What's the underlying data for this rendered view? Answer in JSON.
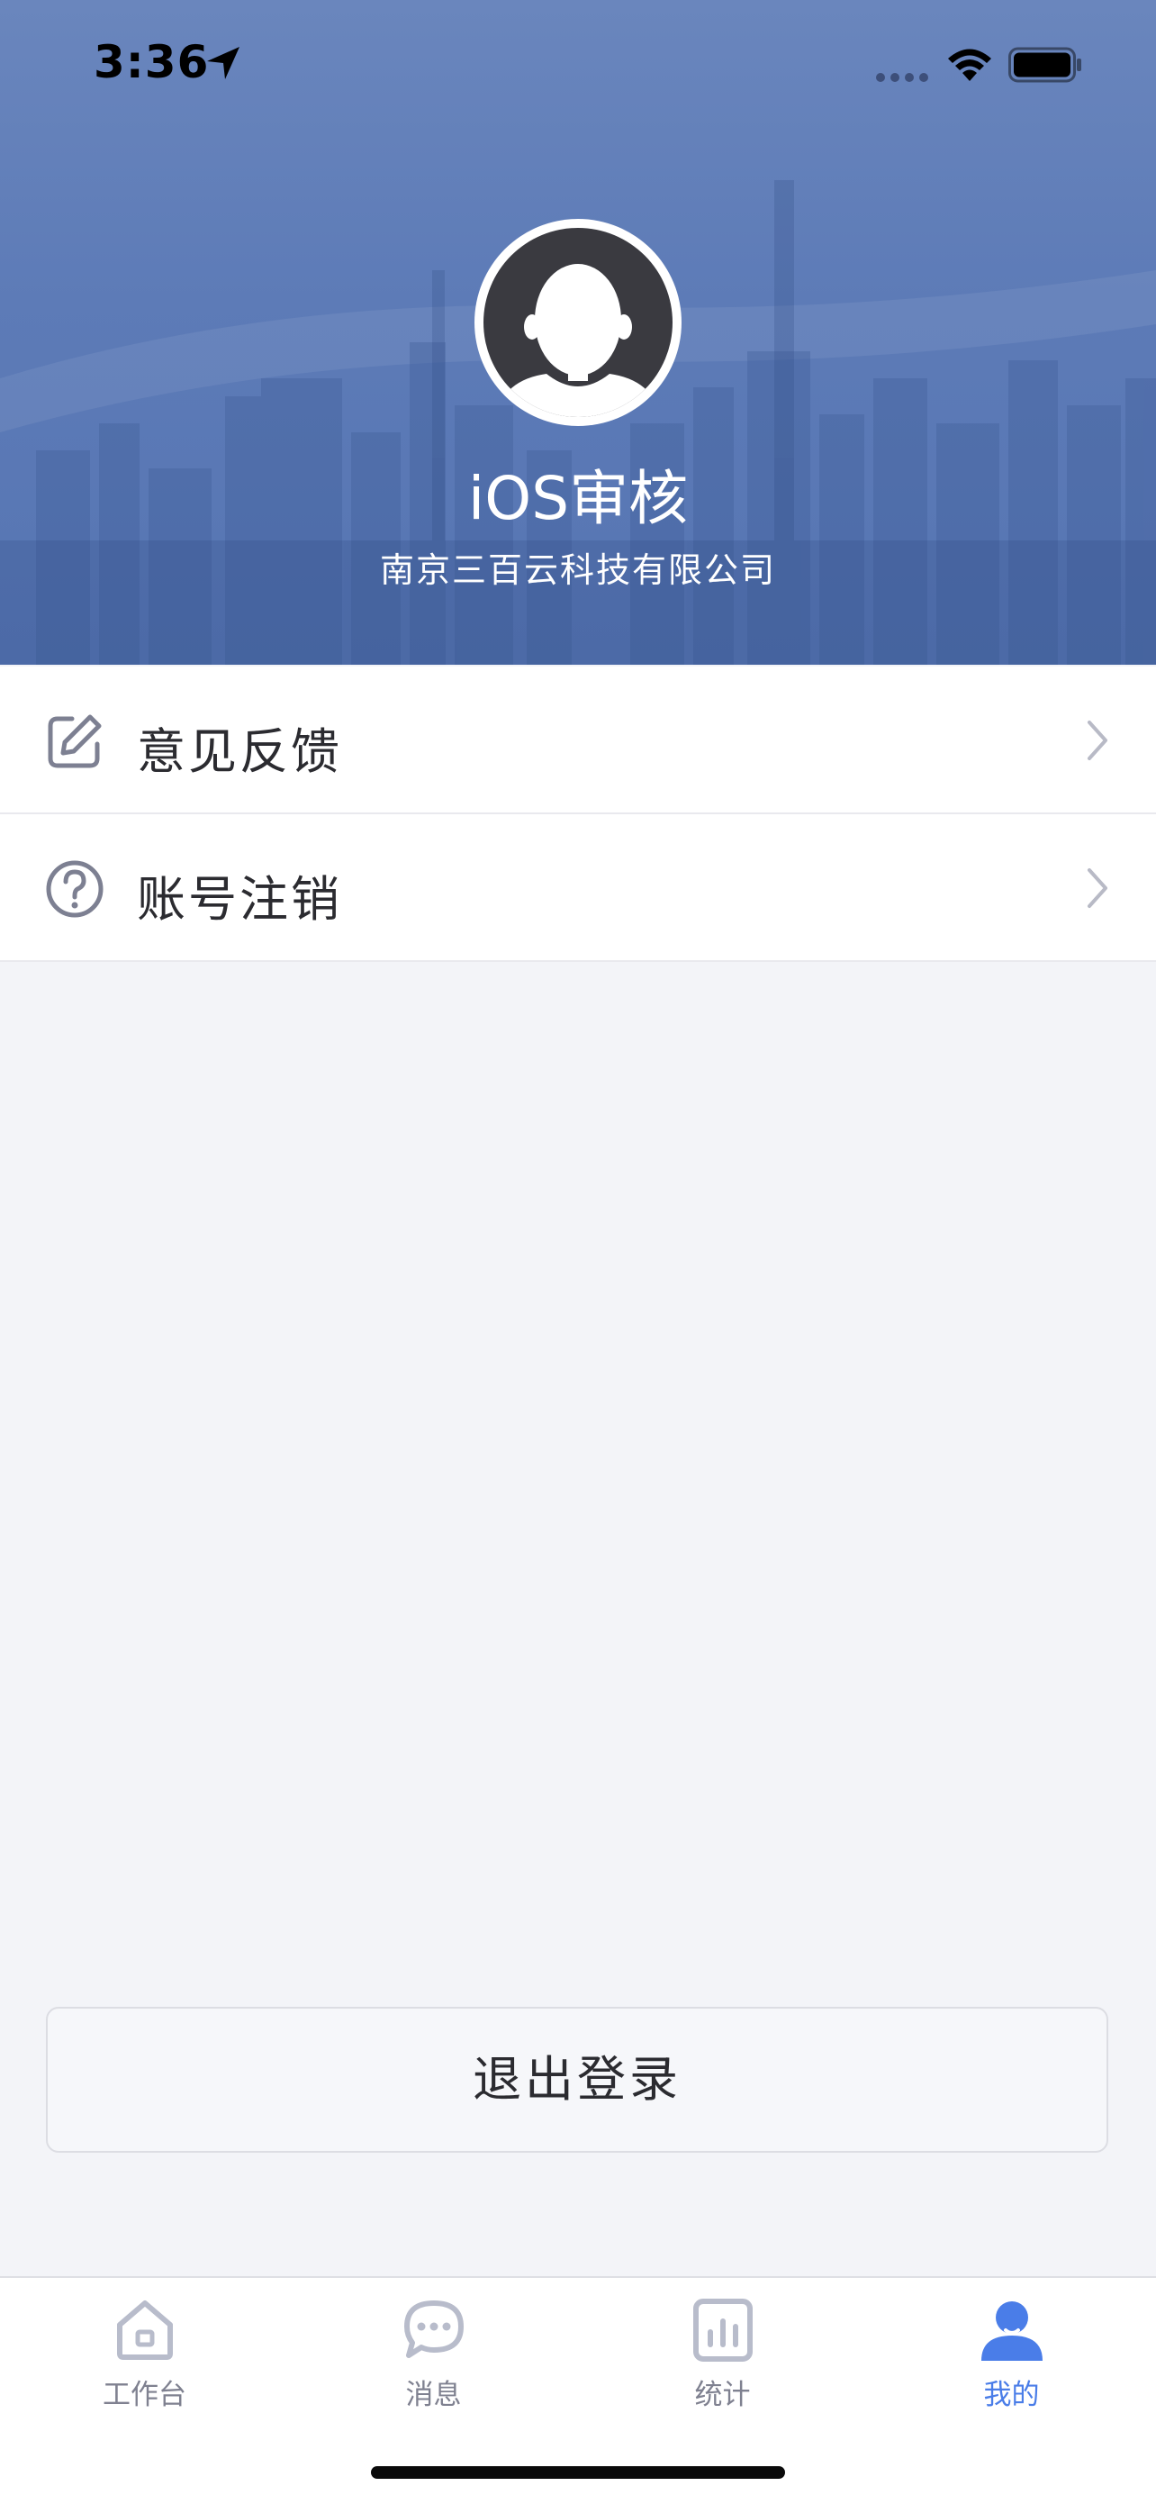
{
  "status_bar": {
    "time": "3:36"
  },
  "profile": {
    "name": "iOS审核",
    "company": "南京三百云科技有限公司"
  },
  "menu": {
    "items": [
      {
        "label": "意见反馈",
        "icon": "edit-icon"
      },
      {
        "label": "账号注销",
        "icon": "question-circle-icon"
      }
    ]
  },
  "logout": {
    "label": "退出登录"
  },
  "tabbar": {
    "active": "我的",
    "tabs": [
      {
        "label": "工作台",
        "icon": "home-icon"
      },
      {
        "label": "消息",
        "icon": "chat-icon"
      },
      {
        "label": "统计",
        "icon": "bar-chart-icon"
      },
      {
        "label": "我的",
        "icon": "user-icon"
      }
    ]
  },
  "colors": {
    "hero_blue": "#5d7bb7",
    "accent": "#4a7de8",
    "background": "#f3f4f8",
    "inactive_icon": "#b8bccb"
  }
}
